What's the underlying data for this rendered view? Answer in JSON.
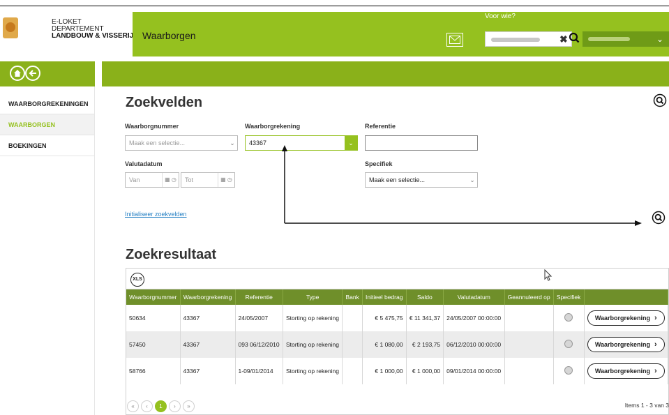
{
  "header": {
    "dept_lines": [
      "E-LOKET",
      "DEPARTEMENT",
      "LANDBOUW & VISSERIJ"
    ],
    "app_title": "Waarborgen",
    "voor_wie_label": "Voor wie?",
    "clear_symbol": "✖"
  },
  "sidebar": {
    "items": [
      {
        "label": "WAARBORGREKENINGEN"
      },
      {
        "label": "WAARBORGEN"
      },
      {
        "label": "BOEKINGEN"
      }
    ]
  },
  "search": {
    "title": "Zoekvelden",
    "waarborgnummer_label": "Waarborgnummer",
    "waarborgnummer_placeholder": "Maak een selectie...",
    "waarborgrekening_label": "Waarborgrekening",
    "waarborgrekening_value": "43367",
    "referentie_label": "Referentie",
    "referentie_value": "",
    "valutadatum_label": "Valutadatum",
    "van_placeholder": "Van",
    "tot_placeholder": "Tot",
    "specifiek_label": "Specifiek",
    "specifiek_value": "Maak een selectie...",
    "reset_link": "Initialiseer zoekvelden"
  },
  "results": {
    "title": "Zoekresultaat",
    "xls_label": "XLS",
    "columns": [
      "Waarborgnummer",
      "Waarborgrekening",
      "Referentie",
      "Type",
      "Bank",
      "Initieel bedrag",
      "Saldo",
      "Valutadatum",
      "Geannuleerd op",
      "Specifiek",
      ""
    ],
    "rows": [
      {
        "nummer": "50634",
        "rekening": "43367",
        "referentie": "24/05/2007",
        "type": "Storting op rekening",
        "bank": "",
        "initieel": "€ 5 475,75",
        "saldo": "€ 11 341,37",
        "valutadatum": "24/05/2007 00:00:00",
        "geannuleerd": "",
        "action": "Waarborgrekening"
      },
      {
        "nummer": "57450",
        "rekening": "43367",
        "referentie": "093 06/12/2010",
        "type": "Storting op rekening",
        "bank": "",
        "initieel": "€ 1 080,00",
        "saldo": "€ 2 193,75",
        "valutadatum": "06/12/2010 00:00:00",
        "geannuleerd": "",
        "action": "Waarborgrekening"
      },
      {
        "nummer": "58766",
        "rekening": "43367",
        "referentie": "1-09/01/2014",
        "type": "Storting op rekening",
        "bank": "",
        "initieel": "€ 1 000,00",
        "saldo": "€ 1 000,00",
        "valutadatum": "09/01/2014 00:00:00",
        "geannuleerd": "",
        "action": "Waarborgrekening"
      }
    ],
    "pager": {
      "first": "«",
      "prev": "‹",
      "current": "1",
      "next": "›",
      "last": "»"
    },
    "items_info": "Items 1 - 3 van 3"
  },
  "colors": {
    "brand_green": "#95c11f",
    "subbar_green": "#8ab11a",
    "table_header": "#6f8f2a",
    "link_blue": "#2a83c5"
  }
}
